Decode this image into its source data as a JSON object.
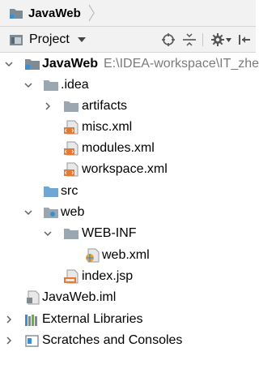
{
  "navbar": {
    "project_name": "JavaWeb"
  },
  "toolbar": {
    "view_label": "Project"
  },
  "tree": {
    "root": {
      "label": "JavaWeb",
      "path": "E:\\IDEA-workspace\\IT_zher"
    },
    "idea_folder": ".idea",
    "artifacts": "artifacts",
    "misc": "misc.xml",
    "modules": "modules.xml",
    "workspace": "workspace.xml",
    "src": "src",
    "web": "web",
    "webinf": "WEB-INF",
    "webxml": "web.xml",
    "indexjsp": "index.jsp",
    "iml": "JavaWeb.iml",
    "external_libraries": "External Libraries",
    "scratches": "Scratches and Consoles"
  },
  "colors": {
    "folder": "#9aa7b0",
    "module_folder": "#7f8b94",
    "xml_badge": "#e07b39",
    "web_folder_dot": "#3c8fcc",
    "arrow": "#606060"
  }
}
